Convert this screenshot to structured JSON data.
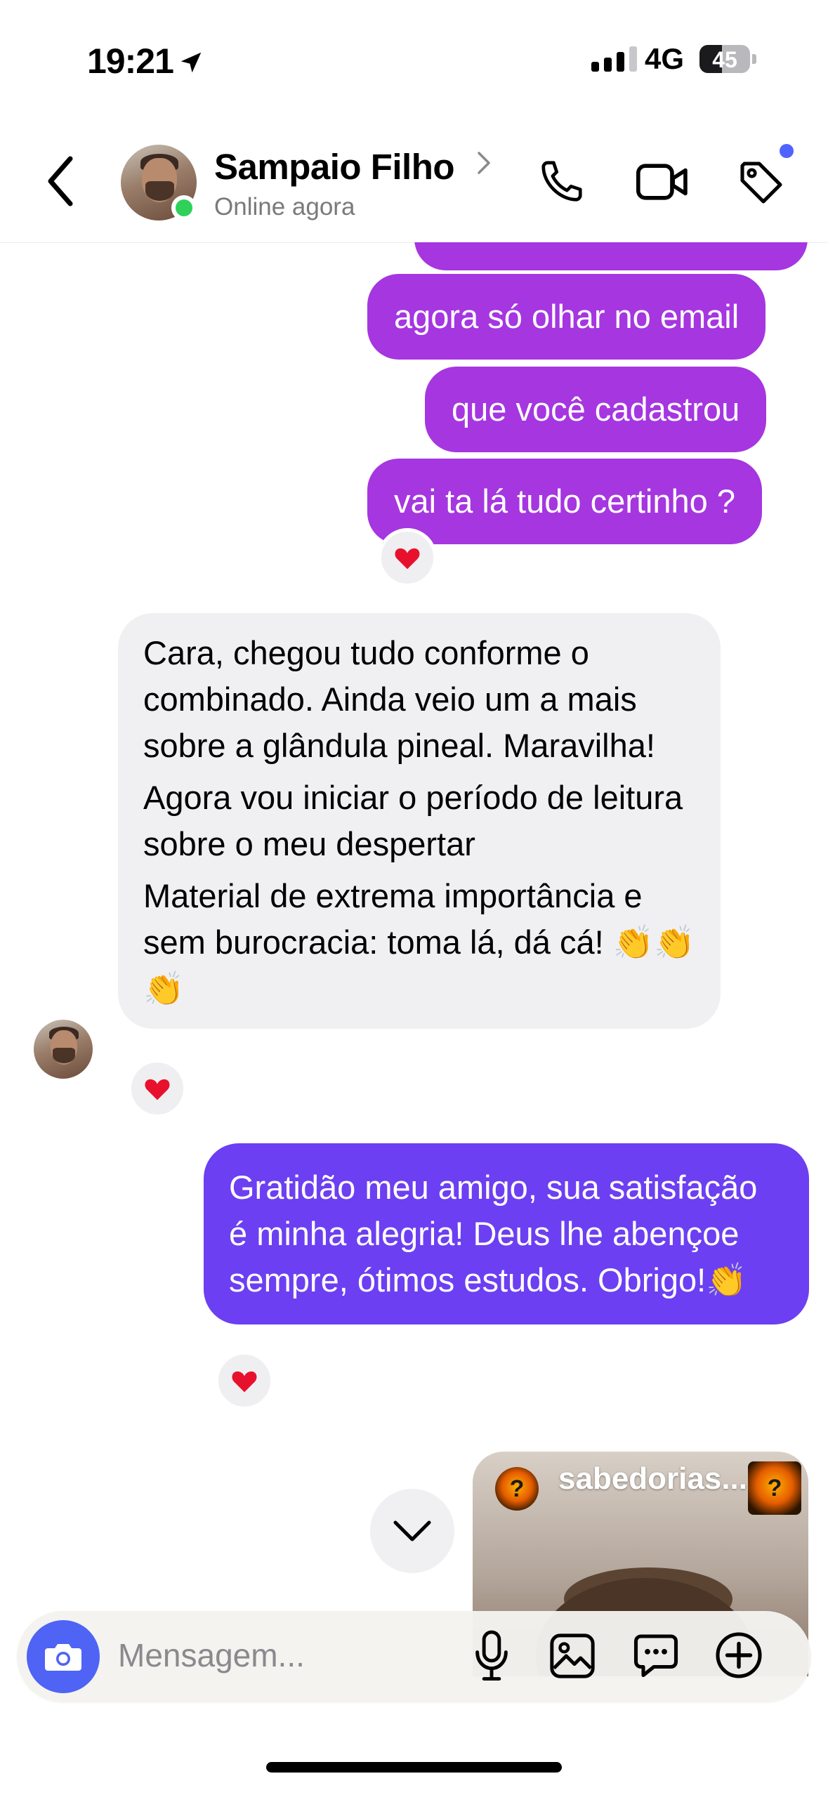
{
  "status_bar": {
    "time": "19:21",
    "network": "4G",
    "battery": "45",
    "battery_level": 0.45
  },
  "header": {
    "contact_name": "Sampaio Filho",
    "contact_status": "Online agora"
  },
  "messages": [
    {
      "text": "agora só olhar no email"
    },
    {
      "text": "que você cadastrou"
    },
    {
      "text": "vai ta lá tudo certinho ?",
      "reaction": "❤️"
    },
    {
      "paragraphs": [
        "Cara, chegou tudo conforme o combinado. Ainda veio um a mais sobre a glândula pineal. Maravilha!",
        "Agora vou iniciar o período de leitura sobre o meu despertar",
        "Material de extrema importância e sem burocracia: toma lá, dá cá! 👏👏👏"
      ],
      "reaction": "❤️"
    },
    {
      "text": "Gratidão meu amigo, sua satisfação é minha alegria! Deus lhe abençoe sempre, ótimos estudos. Obrigo!👏",
      "reaction": "❤️"
    }
  ],
  "shared_post": {
    "account": "sabedorias..."
  },
  "composer": {
    "placeholder": "Mensagem..."
  },
  "colors": {
    "outgoing": "#a536e0",
    "outgoing_latest": "#6c3ff2",
    "incoming": "#f0f0f2",
    "accent": "#4f63f5",
    "online": "#2fd159"
  },
  "icons": [
    "location-arrow-icon",
    "signal-icon",
    "battery-icon",
    "back-chevron-icon",
    "chevron-right-icon",
    "phone-icon",
    "video-icon",
    "tag-icon",
    "heart-icon",
    "chevron-down-icon",
    "camera-icon",
    "microphone-icon",
    "image-icon",
    "sticker-icon",
    "plus-circle-icon"
  ]
}
